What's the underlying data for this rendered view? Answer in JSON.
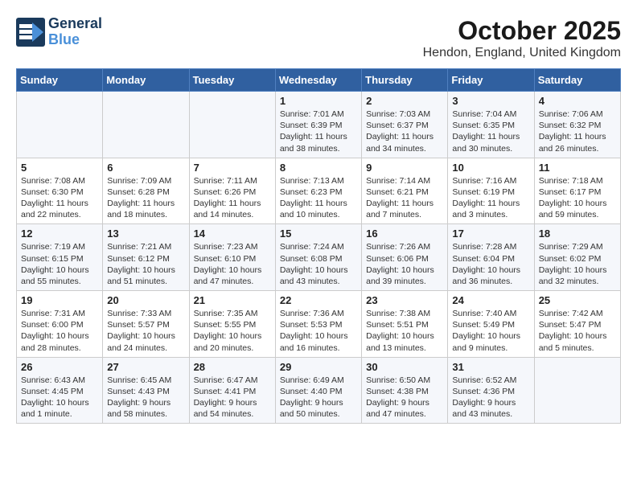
{
  "header": {
    "logo_line1": "General",
    "logo_line2": "Blue",
    "month": "October 2025",
    "location": "Hendon, England, United Kingdom"
  },
  "weekdays": [
    "Sunday",
    "Monday",
    "Tuesday",
    "Wednesday",
    "Thursday",
    "Friday",
    "Saturday"
  ],
  "weeks": [
    [
      {
        "day": "",
        "info": ""
      },
      {
        "day": "",
        "info": ""
      },
      {
        "day": "",
        "info": ""
      },
      {
        "day": "1",
        "info": "Sunrise: 7:01 AM\nSunset: 6:39 PM\nDaylight: 11 hours\nand 38 minutes."
      },
      {
        "day": "2",
        "info": "Sunrise: 7:03 AM\nSunset: 6:37 PM\nDaylight: 11 hours\nand 34 minutes."
      },
      {
        "day": "3",
        "info": "Sunrise: 7:04 AM\nSunset: 6:35 PM\nDaylight: 11 hours\nand 30 minutes."
      },
      {
        "day": "4",
        "info": "Sunrise: 7:06 AM\nSunset: 6:32 PM\nDaylight: 11 hours\nand 26 minutes."
      }
    ],
    [
      {
        "day": "5",
        "info": "Sunrise: 7:08 AM\nSunset: 6:30 PM\nDaylight: 11 hours\nand 22 minutes."
      },
      {
        "day": "6",
        "info": "Sunrise: 7:09 AM\nSunset: 6:28 PM\nDaylight: 11 hours\nand 18 minutes."
      },
      {
        "day": "7",
        "info": "Sunrise: 7:11 AM\nSunset: 6:26 PM\nDaylight: 11 hours\nand 14 minutes."
      },
      {
        "day": "8",
        "info": "Sunrise: 7:13 AM\nSunset: 6:23 PM\nDaylight: 11 hours\nand 10 minutes."
      },
      {
        "day": "9",
        "info": "Sunrise: 7:14 AM\nSunset: 6:21 PM\nDaylight: 11 hours\nand 7 minutes."
      },
      {
        "day": "10",
        "info": "Sunrise: 7:16 AM\nSunset: 6:19 PM\nDaylight: 11 hours\nand 3 minutes."
      },
      {
        "day": "11",
        "info": "Sunrise: 7:18 AM\nSunset: 6:17 PM\nDaylight: 10 hours\nand 59 minutes."
      }
    ],
    [
      {
        "day": "12",
        "info": "Sunrise: 7:19 AM\nSunset: 6:15 PM\nDaylight: 10 hours\nand 55 minutes."
      },
      {
        "day": "13",
        "info": "Sunrise: 7:21 AM\nSunset: 6:12 PM\nDaylight: 10 hours\nand 51 minutes."
      },
      {
        "day": "14",
        "info": "Sunrise: 7:23 AM\nSunset: 6:10 PM\nDaylight: 10 hours\nand 47 minutes."
      },
      {
        "day": "15",
        "info": "Sunrise: 7:24 AM\nSunset: 6:08 PM\nDaylight: 10 hours\nand 43 minutes."
      },
      {
        "day": "16",
        "info": "Sunrise: 7:26 AM\nSunset: 6:06 PM\nDaylight: 10 hours\nand 39 minutes."
      },
      {
        "day": "17",
        "info": "Sunrise: 7:28 AM\nSunset: 6:04 PM\nDaylight: 10 hours\nand 36 minutes."
      },
      {
        "day": "18",
        "info": "Sunrise: 7:29 AM\nSunset: 6:02 PM\nDaylight: 10 hours\nand 32 minutes."
      }
    ],
    [
      {
        "day": "19",
        "info": "Sunrise: 7:31 AM\nSunset: 6:00 PM\nDaylight: 10 hours\nand 28 minutes."
      },
      {
        "day": "20",
        "info": "Sunrise: 7:33 AM\nSunset: 5:57 PM\nDaylight: 10 hours\nand 24 minutes."
      },
      {
        "day": "21",
        "info": "Sunrise: 7:35 AM\nSunset: 5:55 PM\nDaylight: 10 hours\nand 20 minutes."
      },
      {
        "day": "22",
        "info": "Sunrise: 7:36 AM\nSunset: 5:53 PM\nDaylight: 10 hours\nand 16 minutes."
      },
      {
        "day": "23",
        "info": "Sunrise: 7:38 AM\nSunset: 5:51 PM\nDaylight: 10 hours\nand 13 minutes."
      },
      {
        "day": "24",
        "info": "Sunrise: 7:40 AM\nSunset: 5:49 PM\nDaylight: 10 hours\nand 9 minutes."
      },
      {
        "day": "25",
        "info": "Sunrise: 7:42 AM\nSunset: 5:47 PM\nDaylight: 10 hours\nand 5 minutes."
      }
    ],
    [
      {
        "day": "26",
        "info": "Sunrise: 6:43 AM\nSunset: 4:45 PM\nDaylight: 10 hours\nand 1 minute."
      },
      {
        "day": "27",
        "info": "Sunrise: 6:45 AM\nSunset: 4:43 PM\nDaylight: 9 hours\nand 58 minutes."
      },
      {
        "day": "28",
        "info": "Sunrise: 6:47 AM\nSunset: 4:41 PM\nDaylight: 9 hours\nand 54 minutes."
      },
      {
        "day": "29",
        "info": "Sunrise: 6:49 AM\nSunset: 4:40 PM\nDaylight: 9 hours\nand 50 minutes."
      },
      {
        "day": "30",
        "info": "Sunrise: 6:50 AM\nSunset: 4:38 PM\nDaylight: 9 hours\nand 47 minutes."
      },
      {
        "day": "31",
        "info": "Sunrise: 6:52 AM\nSunset: 4:36 PM\nDaylight: 9 hours\nand 43 minutes."
      },
      {
        "day": "",
        "info": ""
      }
    ]
  ]
}
